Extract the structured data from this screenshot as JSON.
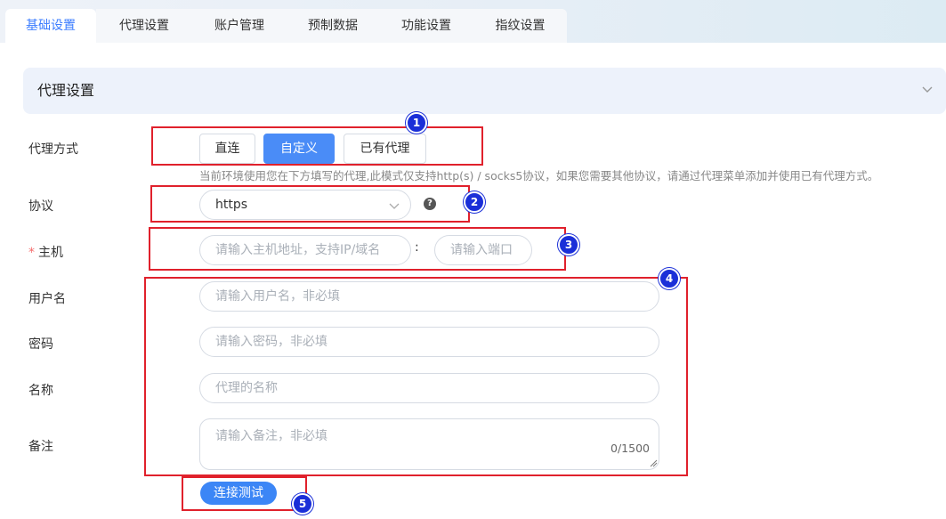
{
  "tabs": [
    {
      "label": "基础设置",
      "active": true
    },
    {
      "label": "代理设置",
      "active": false
    },
    {
      "label": "账户管理",
      "active": false
    },
    {
      "label": "预制数据",
      "active": false
    },
    {
      "label": "功能设置",
      "active": false
    },
    {
      "label": "指纹设置",
      "active": false
    }
  ],
  "section": {
    "title": "代理设置",
    "collapse_icon": "chevron-down-icon"
  },
  "proxy_mode": {
    "label": "代理方式",
    "options": [
      "直连",
      "自定义",
      "已有代理"
    ],
    "selected": "自定义",
    "hint": "当前环境使用您在下方填写的代理,此模式仅支持http(s) / socks5协议，如果您需要其他协议，请通过代理菜单添加并使用已有代理方式。"
  },
  "protocol": {
    "label": "协议",
    "value": "https",
    "help_icon": "question-circle-icon"
  },
  "host": {
    "label": "主机",
    "required_mark": "*",
    "host_placeholder": "请输入主机地址，支持IP/域名",
    "separator": ":",
    "port_placeholder": "请输入端口"
  },
  "username": {
    "label": "用户名",
    "placeholder": "请输入用户名，非必填"
  },
  "password": {
    "label": "密码",
    "placeholder": "请输入密码，非必填"
  },
  "name": {
    "label": "名称",
    "placeholder": "代理的名称"
  },
  "remark": {
    "label": "备注",
    "placeholder": "请输入备注，非必填",
    "counter": "0/1500"
  },
  "test_button": {
    "label": "连接测试"
  },
  "annotations": {
    "markers": [
      "1",
      "2",
      "3",
      "4",
      "5"
    ],
    "box_color": "#e0212c",
    "marker_color": "#1a2fd8"
  },
  "colors": {
    "accent": "#4a8cf7",
    "section_bg": "#edf2fb"
  }
}
